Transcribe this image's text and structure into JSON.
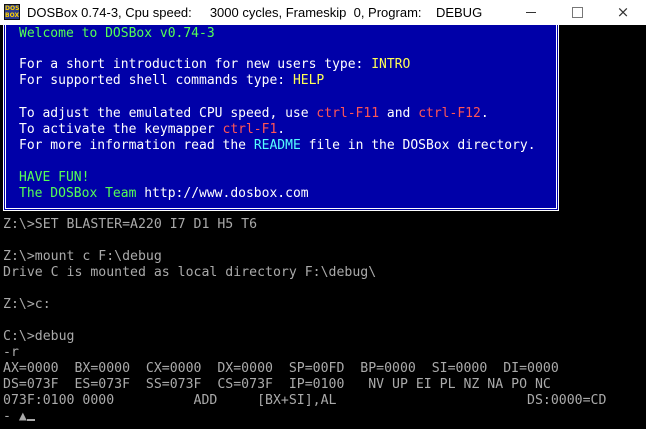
{
  "window": {
    "title": "DOSBox 0.74-3, Cpu speed:     3000 cycles, Frameskip  0, Program:    DEBUG",
    "icon_name": "dosbox-icon",
    "icon_text": "DOS BOX",
    "controls": {
      "minimize": "minimize-icon",
      "maximize": "maximize-icon",
      "close": "×"
    }
  },
  "colors": {
    "banner_bg": "#0000a8",
    "green": "#55ff55",
    "yellow": "#ffff55",
    "red": "#ff5555",
    "cyan": "#55ffff",
    "console_text": "#aaaaaa"
  },
  "banner": {
    "welcome": "Welcome to DOSBox v0.74-3",
    "intro_prefix": "For a short introduction for new users type: ",
    "intro_cmd": "INTRO",
    "help_prefix": "For supported shell commands type: ",
    "help_cmd": "HELP",
    "cpu_prefix": "To adjust the emulated CPU speed, use ",
    "cpu_key1": "ctrl-F11",
    "cpu_and": " and ",
    "cpu_key2": "ctrl-F12",
    "cpu_suffix": ".",
    "keymap_prefix": "To activate the keymapper ",
    "keymap_key": "ctrl-F1",
    "keymap_suffix": ".",
    "info_prefix": "For more information read the ",
    "info_readme": "README",
    "info_suffix": " file in the DOSBox directory.",
    "have_fun": "HAVE FUN!",
    "team_prefix": "The DOSBox Team ",
    "team_url": "http://www.dosbox.com"
  },
  "console": {
    "lines": [
      "Z:\\>SET BLASTER=A220 I7 D1 H5 T6",
      "",
      "Z:\\>mount c F:\\debug",
      "Drive C is mounted as local directory F:\\debug\\",
      "",
      "Z:\\>c:",
      "",
      "C:\\>debug",
      "-r",
      "AX=0000  BX=0000  CX=0000  DX=0000  SP=00FD  BP=0000  SI=0000  DI=0000",
      "DS=073F  ES=073F  SS=073F  CS=073F  IP=0100   NV UP EI PL NZ NA PO NC",
      "073F:0100 0000          ADD     [BX+SI],AL                        DS:0000=CD"
    ],
    "prompt": "- ▲"
  }
}
